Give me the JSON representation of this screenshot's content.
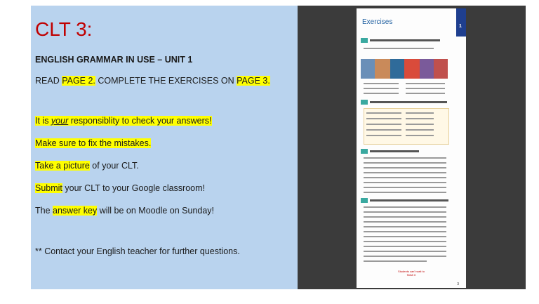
{
  "slide": {
    "title": "CLT 3:",
    "subtitle": "ENGLISH GRAMMAR IN USE – UNIT 1",
    "instruction": {
      "part1": "READ ",
      "hl1": "PAGE 2.",
      "part2": "  COMPLETE THE EXERCISES ON ",
      "hl2": "PAGE 3."
    },
    "bullets": {
      "responsibility": {
        "pre": "It is ",
        "em": "your",
        "post": " responsiblity to check your answers!"
      },
      "fix": "Make sure to fix the mistakes.  ",
      "picture": {
        "hl": "Take a picture",
        "rest": " of your CLT."
      },
      "submit": {
        "hl": "Submit",
        "rest": " your CLT to your Google classroom!"
      },
      "answer": {
        "pre": "The ",
        "hl": "answer key",
        "post": " will be on Moodle on Sunday!"
      }
    },
    "contact": "** Contact your English teacher for further questions."
  },
  "preview": {
    "heading": "Exercises",
    "unit_number": "1",
    "footer_note": "Students can't wait to finish it",
    "page_number": "3"
  },
  "colors": {
    "slide_bg": "#b9d3ee",
    "title": "#c00000",
    "highlight": "#ffff00",
    "viewer_bg": "#3b3b3b",
    "exercise_tab": "#3aa9a0",
    "unit_bar": "#1f3f8f"
  }
}
